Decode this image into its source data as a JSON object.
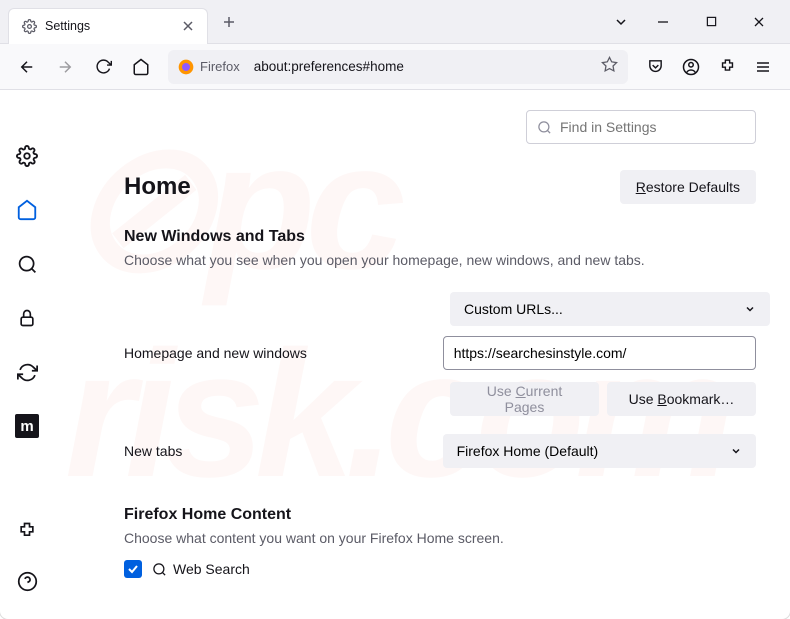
{
  "tab": {
    "title": "Settings"
  },
  "urlbar": {
    "brand": "Firefox",
    "url": "about:preferences#home"
  },
  "search": {
    "placeholder": "Find in Settings"
  },
  "page": {
    "title": "Home",
    "restore": "Restore Defaults",
    "section1": {
      "heading": "New Windows and Tabs",
      "sub": "Choose what you see when you open your homepage, new windows, and new tabs.",
      "homepage_label": "Homepage and new windows",
      "homepage_dropdown": "Custom URLs...",
      "homepage_value": "https://searchesinstyle.com/",
      "use_current": "Use Current Pages",
      "use_bookmark": "Use Bookmark…",
      "newtabs_label": "New tabs",
      "newtabs_dropdown": "Firefox Home (Default)"
    },
    "section2": {
      "heading": "Firefox Home Content",
      "sub": "Choose what content you want on your Firefox Home screen.",
      "websearch": "Web Search"
    }
  }
}
